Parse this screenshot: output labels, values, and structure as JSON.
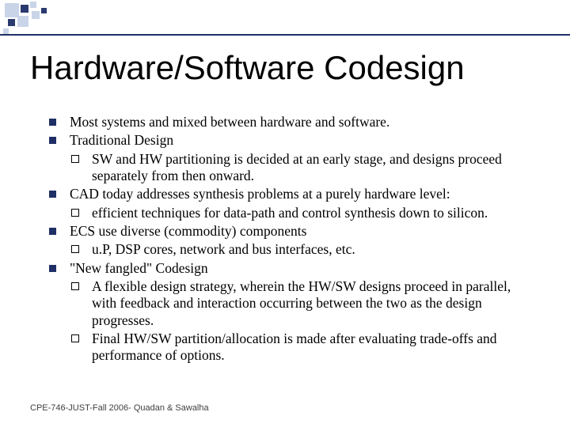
{
  "title": "Hardware/Software Codesign",
  "bullets": {
    "b1": "Most systems and mixed between hardware and software.",
    "b2": "Traditional Design",
    "b2s1": "SW and HW partitioning is decided at an early stage, and designs proceed separately from then onward.",
    "b3": "CAD today addresses synthesis problems at a purely hardware level:",
    "b3s1": "efficient techniques for data-path and control synthesis down to silicon.",
    "b4": "ECS use diverse (commodity) components",
    "b4s1": "u.P, DSP cores, network and bus interfaces, etc.",
    "b5": "\"New fangled\" Codesign",
    "b5s1": "A flexible design strategy, wherein the HW/SW designs proceed in parallel, with feedback and interaction occurring between the two as the design progresses.",
    "b5s2": "Final HW/SW partition/allocation is made after evaluating trade-offs and performance of options."
  },
  "footer": "CPE-746-JUST-Fall 2006- Quadan & Sawalha"
}
